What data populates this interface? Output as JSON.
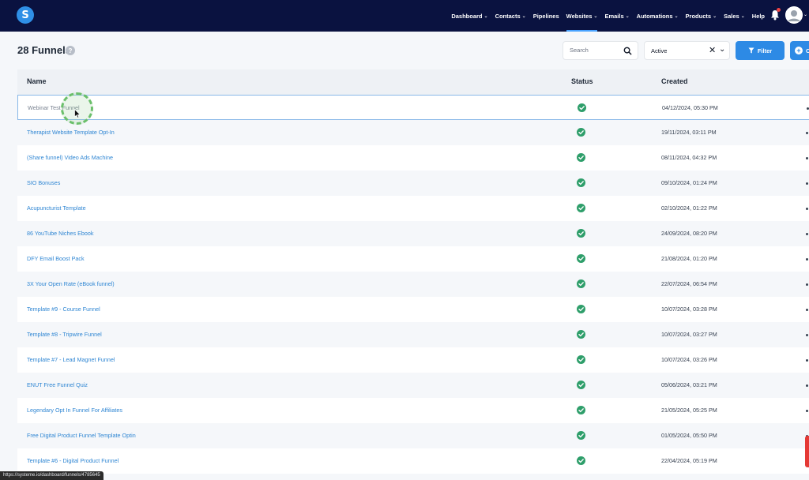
{
  "navbar": {
    "logo_letter": "S",
    "items": [
      {
        "label": "Dashboard",
        "has_menu": true
      },
      {
        "label": "Contacts",
        "has_menu": true
      },
      {
        "label": "Pipelines",
        "has_menu": false
      },
      {
        "label": "Websites",
        "has_menu": true,
        "active": true
      },
      {
        "label": "Emails",
        "has_menu": true
      },
      {
        "label": "Automations",
        "has_menu": true
      },
      {
        "label": "Products",
        "has_menu": true
      },
      {
        "label": "Sales",
        "has_menu": true
      },
      {
        "label": "Help",
        "has_menu": false
      }
    ],
    "chevron": "⌄",
    "icons": {
      "notifications": "bell-icon",
      "profile": "avatar"
    }
  },
  "header": {
    "title": "28 Funnels",
    "help_glyph": "?"
  },
  "toolbar": {
    "search_placeholder": "Search",
    "status_value": "Active",
    "clear_glyph": "✕",
    "dropdown_glyph": "⌄",
    "filter_label": "Filter",
    "create_label": "C"
  },
  "table": {
    "columns": {
      "name": "Name",
      "status": "Status",
      "created": "Created"
    },
    "rows": [
      {
        "name": "Webinar Test Funnel",
        "created": "04/12/2024, 05:30 PM",
        "selected": true
      },
      {
        "name": "Therapist Website Template Opt-In",
        "created": "19/11/2024, 03:11 PM"
      },
      {
        "name": "(Share funnel) Video Ads Machine",
        "created": "08/11/2024, 04:32 PM"
      },
      {
        "name": "SIO Bonuses",
        "created": "09/10/2024, 01:24 PM"
      },
      {
        "name": "Acupuncturist Template",
        "created": "02/10/2024, 01:22 PM"
      },
      {
        "name": "86 YouTube Niches Ebook",
        "created": "24/09/2024, 08:20 PM"
      },
      {
        "name": "DFY Email Boost Pack",
        "created": "21/08/2024, 01:20 PM"
      },
      {
        "name": "3X Your Open Rate (eBook funnel)",
        "created": "22/07/2024, 06:54 PM"
      },
      {
        "name": "Template #9 - Course Funnel",
        "created": "10/07/2024, 03:28 PM"
      },
      {
        "name": "Template #8 - Tripwire Funnel",
        "created": "10/07/2024, 03:27 PM"
      },
      {
        "name": "Template #7 - Lead Magnet Funnel",
        "created": "10/07/2024, 03:26 PM"
      },
      {
        "name": "ENUT Free Funnel Quiz",
        "created": "05/06/2024, 03:21 PM"
      },
      {
        "name": "Legendary Opt In Funnel For Affiliates",
        "created": "21/05/2024, 05:25 PM"
      },
      {
        "name": "Free Digital Product Funnel Template Optin",
        "created": "01/05/2024, 05:50 PM"
      },
      {
        "name": "Template #6 - Digital Product Funnel",
        "created": "22/04/2024, 05:19 PM"
      }
    ]
  },
  "statusbar": {
    "url": "https://systeme.io/dashboard/funnels/4785645"
  },
  "colors": {
    "navbar_bg": "#0a1240",
    "accent": "#2d8ae5",
    "link": "#2f86d3",
    "status_ok": "#2e9e6a"
  }
}
